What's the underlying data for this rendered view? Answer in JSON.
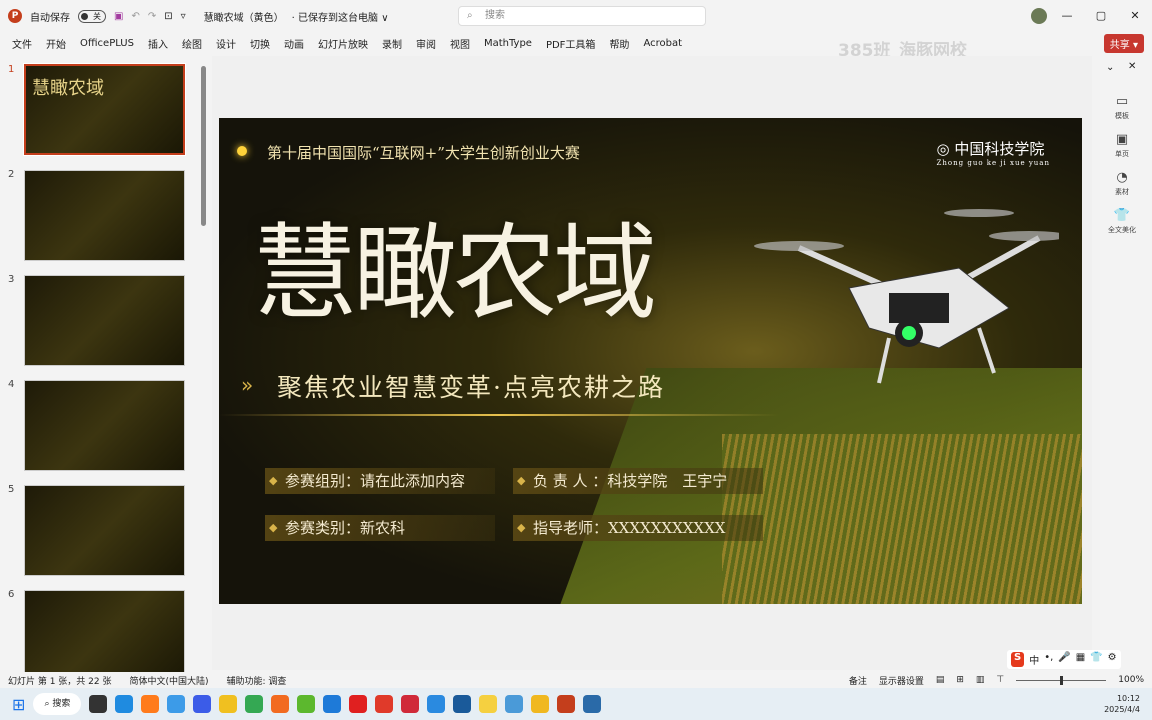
{
  "titlebar": {
    "autosave_label": "自动保存",
    "autosave_state": "关",
    "doc_title": "慧瞰农域（黄色）",
    "save_status": "· 已保存到这台电脑 ∨",
    "search_placeholder": "搜索"
  },
  "menu": [
    "文件",
    "开始",
    "OfficePLUS",
    "插入",
    "绘图",
    "设计",
    "切换",
    "动画",
    "幻灯片放映",
    "录制",
    "审阅",
    "视图",
    "MathType",
    "PDF工具箱",
    "帮助",
    "Acrobat"
  ],
  "share_label": "共享 ▾",
  "watermark": "385班_海豚网校",
  "thumbnails": [
    {
      "num": "1",
      "text": "慧瞰农域"
    },
    {
      "num": "2",
      "text": ""
    },
    {
      "num": "3",
      "text": ""
    },
    {
      "num": "4",
      "text": ""
    },
    {
      "num": "5",
      "text": ""
    },
    {
      "num": "6",
      "text": ""
    }
  ],
  "slide": {
    "competition": "第十届中国国际“互联网+”大学生创新创业大赛",
    "school": "中国科技学院",
    "school_pinyin": "Zhong guo ke ji xue yuan",
    "title": "慧瞰农域",
    "subtitle": "聚焦农业智慧变革·点亮农耕之路",
    "info": [
      "参赛组别：请在此添加内容",
      "负 责 人 ：科技学院　王宇宁",
      "参赛类别：新农科",
      "指导老师：XXXXXXXXXXX"
    ]
  },
  "right_panel": [
    "模板",
    "单页",
    "素材",
    "全文美化"
  ],
  "status": {
    "slide_count": "幻灯片 第 1 张，共 22 张",
    "language": "简体中文(中国大陆)",
    "accessibility": "辅助功能: 调查",
    "notes": "备注",
    "display": "显示器设置",
    "zoom": "100%"
  },
  "taskbar": {
    "search": "搜索",
    "time": "10:12",
    "date": "2025/4/4"
  },
  "ime": [
    "中",
    "•,",
    "🎤",
    "▦",
    "👕",
    "⚙"
  ]
}
